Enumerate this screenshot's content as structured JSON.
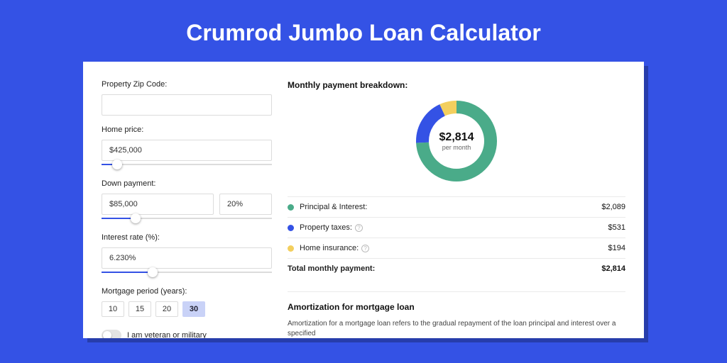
{
  "title": "Crumrod Jumbo Loan Calculator",
  "form": {
    "zip_label": "Property Zip Code:",
    "zip_value": "",
    "home_price_label": "Home price:",
    "home_price_value": "$425,000",
    "down_payment_label": "Down payment:",
    "down_payment_value": "$85,000",
    "down_payment_pct": "20%",
    "interest_label": "Interest rate (%):",
    "interest_value": "6.230%",
    "mortgage_period_label": "Mortgage period (years):",
    "periods": [
      "10",
      "15",
      "20",
      "30"
    ],
    "period_selected": "30",
    "veteran_label": "I am veteran or military"
  },
  "breakdown": {
    "header": "Monthly payment breakdown:",
    "center_amount": "$2,814",
    "center_sub": "per month",
    "items": [
      {
        "label": "Principal & Interest:",
        "value": "$2,089",
        "color": "#4aab89",
        "info": false
      },
      {
        "label": "Property taxes:",
        "value": "$531",
        "color": "#3452e5",
        "info": true
      },
      {
        "label": "Home insurance:",
        "value": "$194",
        "color": "#f3cf5e",
        "info": true
      }
    ],
    "total_label": "Total monthly payment:",
    "total_value": "$2,814"
  },
  "amort": {
    "header": "Amortization for mortgage loan",
    "text": "Amortization for a mortgage loan refers to the gradual repayment of the loan principal and interest over a specified"
  },
  "chart_data": {
    "type": "pie",
    "title": "Monthly payment breakdown",
    "series": [
      {
        "name": "Principal & Interest",
        "value": 2089,
        "color": "#4aab89"
      },
      {
        "name": "Property taxes",
        "value": 531,
        "color": "#3452e5"
      },
      {
        "name": "Home insurance",
        "value": 194,
        "color": "#f3cf5e"
      }
    ],
    "total": 2814
  }
}
